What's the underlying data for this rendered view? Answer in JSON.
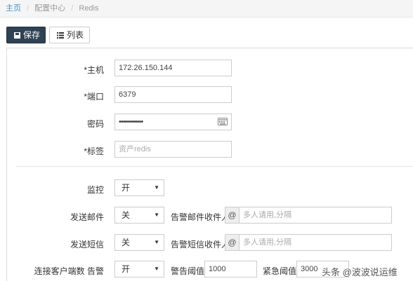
{
  "breadcrumb": {
    "home": "主页",
    "config_center": "配置中心",
    "current": "Redis"
  },
  "toolbar": {
    "save_label": "保存",
    "list_label": "列表"
  },
  "form": {
    "host": {
      "label": "*主机",
      "value": "172.26.150.144"
    },
    "port": {
      "label": "*端口",
      "value": "6379"
    },
    "password": {
      "label": "密码",
      "value": "••••••••••••"
    },
    "tag": {
      "label": "*标签",
      "placeholder": "资产redis"
    },
    "monitor": {
      "label": "监控",
      "selected": "开"
    },
    "send_email": {
      "label": "发送邮件",
      "selected": "关",
      "recipient_label": "告警邮件收件人",
      "addon": "@",
      "placeholder": "多人请用,分隔"
    },
    "send_sms": {
      "label": "发送短信",
      "selected": "关",
      "recipient_label": "告警短信收件人",
      "addon": "@",
      "placeholder": "多人请用,分隔"
    },
    "connections_alert": {
      "label": "连接客户端数 告警",
      "selected": "开",
      "warn_label": "警告阈值",
      "warn_value": "1000",
      "critical_label": "紧急阈值",
      "critical_value": "3000"
    }
  },
  "watermark": "头条 @波波说运维"
}
